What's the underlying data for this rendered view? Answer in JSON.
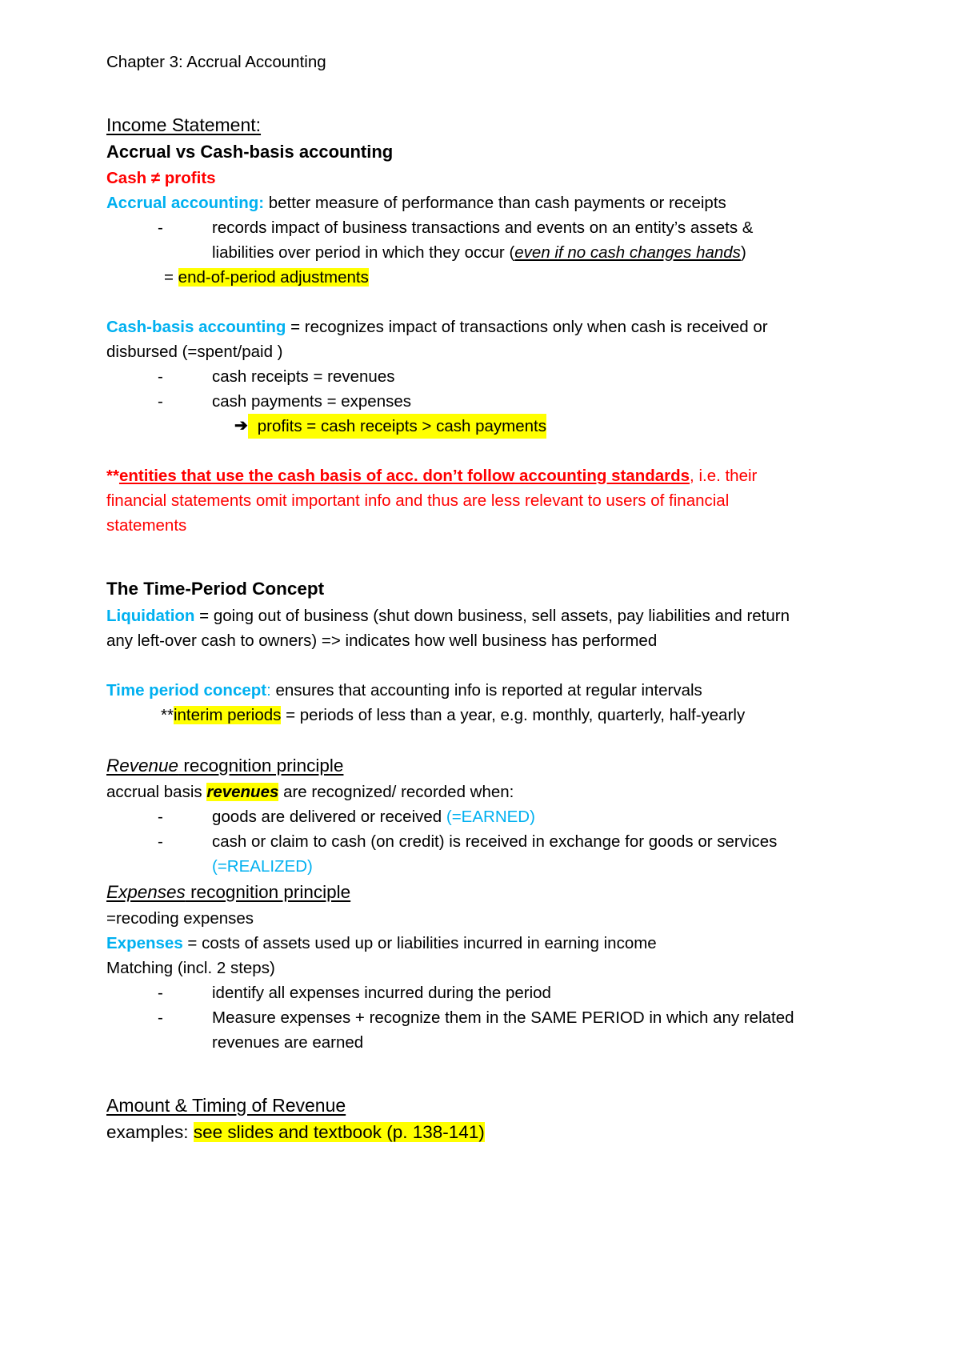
{
  "document": {
    "chapter_title": "Chapter 3: Accrual Accounting",
    "sections": {
      "income_statement": {
        "heading": "Income Statement:",
        "subheading": "Accrual vs Cash-basis accounting",
        "cash_not_profits": "Cash ≠ profits",
        "accrual_label": "Accrual accounting:",
        "accrual_text": " better measure of performance than cash payments or receipts",
        "bullet1_a": "records impact of business transactions and events on an entity’s assets &",
        "bullet1_b_pre": "liabilities over period in which they occur (",
        "bullet1_b_italic": "even if no cash changes hands",
        "bullet1_b_post": ")",
        "equals_prefix": "= ",
        "equals_highlight": "end-of-period adjustments",
        "cashbasis_label": "Cash-basis accounting",
        "cashbasis_text": " = recognizes impact of transactions only when cash is received or",
        "cashbasis_text2": "disbursed (=spent/paid )",
        "bullet_receipts": "cash receipts = revenues",
        "bullet_payments": "cash payments = expenses",
        "arrow_glyph": "➔",
        "arrow_highlight": "profits = cash receipts > cash payments",
        "warning_stars": "**",
        "warning_bold_underline": "entities that use the cash basis of acc. don’t follow accounting standards",
        "warning_rest": ", i.e. their",
        "warning_line2": "financial statements omit important info and thus are less relevant to users of financial",
        "warning_line3": "statements"
      },
      "time_period": {
        "heading": "The Time-Period Concept",
        "liquidation_label": "Liquidation",
        "liquidation_text": " = going out of business (shut down business, sell assets, pay liabilities and return",
        "liquidation_text2": "any left-over cash to owners) => indicates how well business has performed",
        "concept_label": "Time period concept",
        "concept_colon": ":",
        "concept_text": " ensures that accounting info is reported at regular intervals",
        "interim_stars": "**",
        "interim_highlight": "interim periods",
        "interim_text": " = periods of less than a year, e.g. monthly, quarterly, half-yearly"
      },
      "revenue_recognition": {
        "heading_italic": "Revenue",
        "heading_rest": " recognition principle",
        "intro_pre": "accrual basis ",
        "intro_highlight": "revenues",
        "intro_post": " are recognized/ recorded when:",
        "bullet1_text": "goods are delivered or received ",
        "bullet1_cyan": "(=EARNED)",
        "bullet2_text": "cash or claim to cash (on credit) is received in exchange for goods or services",
        "bullet2_cyan": "(=REALIZED)"
      },
      "expenses_recognition": {
        "heading_italic": "Expenses",
        "heading_rest": " recognition principle",
        "recoding": "=recoding expenses",
        "expenses_label": "Expenses",
        "expenses_text": " = costs of assets used up or liabilities incurred in earning income",
        "matching": "Matching (incl. 2 steps)",
        "bullet1": "identify all expenses incurred during the period",
        "bullet2_a": "Measure expenses + recognize them in the SAME PERIOD in which any related",
        "bullet2_b": "revenues are earned"
      },
      "amount_timing": {
        "heading": "Amount & Timing of Revenue",
        "examples_pre": "examples: ",
        "examples_highlight": "see slides and textbook (p. 138-141)"
      }
    },
    "colors": {
      "red": "#ff0000",
      "cyan": "#00b0f0",
      "highlight_yellow": "#ffff00",
      "text": "#000000",
      "page_background": "#ffffff"
    },
    "bullet_dash": "-"
  }
}
